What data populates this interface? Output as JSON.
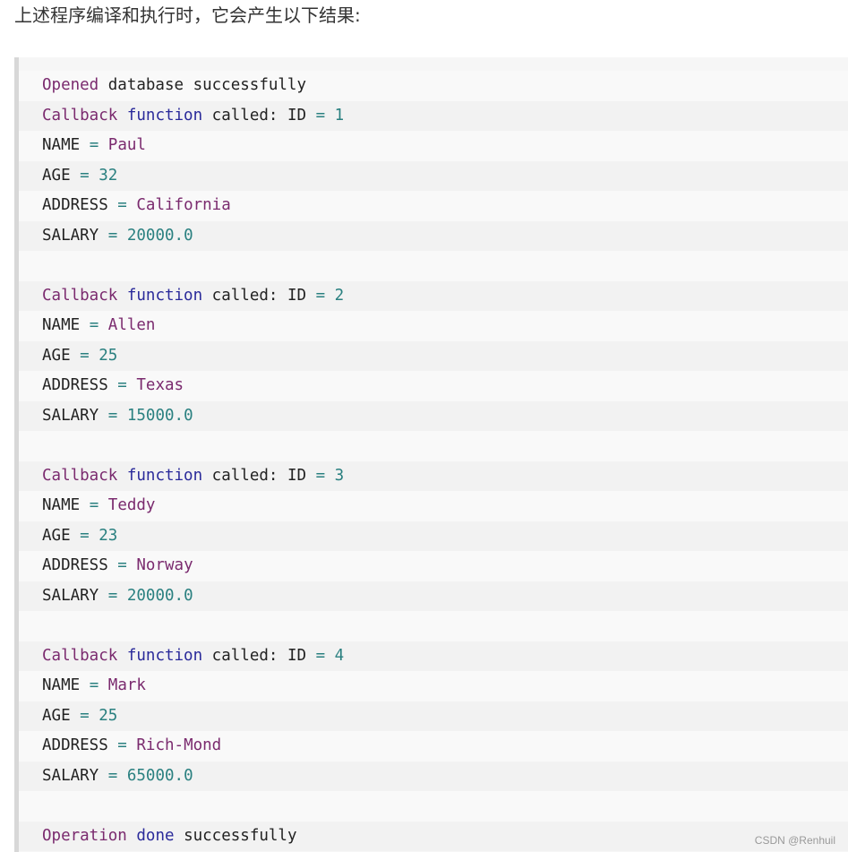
{
  "intro_text": "上述程序编译和执行时，它会产生以下结果:",
  "watermark": "CSDN @Renhuil",
  "colors": {
    "code_background": "#f6f6f6",
    "code_border": "#d8d8d8",
    "keyword": "#7a2a6e",
    "function_keyword": "#2a2a9a",
    "number": "#2a8080",
    "plain": "#222222"
  },
  "output_lines": [
    {
      "segments": [
        {
          "t": "Opened",
          "c": "kw"
        },
        {
          "t": " database successfully",
          "c": ""
        }
      ]
    },
    {
      "segments": [
        {
          "t": "Callback",
          "c": "kw"
        },
        {
          "t": " ",
          "c": ""
        },
        {
          "t": "function",
          "c": "fn"
        },
        {
          "t": " called: ID ",
          "c": ""
        },
        {
          "t": "=",
          "c": "op"
        },
        {
          "t": " ",
          "c": ""
        },
        {
          "t": "1",
          "c": "num"
        }
      ]
    },
    {
      "segments": [
        {
          "t": "NAME ",
          "c": ""
        },
        {
          "t": "=",
          "c": "op"
        },
        {
          "t": " ",
          "c": ""
        },
        {
          "t": "Paul",
          "c": "str"
        }
      ]
    },
    {
      "segments": [
        {
          "t": "AGE ",
          "c": ""
        },
        {
          "t": "=",
          "c": "op"
        },
        {
          "t": " ",
          "c": ""
        },
        {
          "t": "32",
          "c": "num"
        }
      ]
    },
    {
      "segments": [
        {
          "t": "ADDRESS ",
          "c": ""
        },
        {
          "t": "=",
          "c": "op"
        },
        {
          "t": " ",
          "c": ""
        },
        {
          "t": "California",
          "c": "str"
        }
      ]
    },
    {
      "segments": [
        {
          "t": "SALARY ",
          "c": ""
        },
        {
          "t": "=",
          "c": "op"
        },
        {
          "t": " ",
          "c": ""
        },
        {
          "t": "20000.0",
          "c": "num"
        }
      ]
    },
    {
      "segments": []
    },
    {
      "segments": [
        {
          "t": "Callback",
          "c": "kw"
        },
        {
          "t": " ",
          "c": ""
        },
        {
          "t": "function",
          "c": "fn"
        },
        {
          "t": " called: ID ",
          "c": ""
        },
        {
          "t": "=",
          "c": "op"
        },
        {
          "t": " ",
          "c": ""
        },
        {
          "t": "2",
          "c": "num"
        }
      ]
    },
    {
      "segments": [
        {
          "t": "NAME ",
          "c": ""
        },
        {
          "t": "=",
          "c": "op"
        },
        {
          "t": " ",
          "c": ""
        },
        {
          "t": "Allen",
          "c": "str"
        }
      ]
    },
    {
      "segments": [
        {
          "t": "AGE ",
          "c": ""
        },
        {
          "t": "=",
          "c": "op"
        },
        {
          "t": " ",
          "c": ""
        },
        {
          "t": "25",
          "c": "num"
        }
      ]
    },
    {
      "segments": [
        {
          "t": "ADDRESS ",
          "c": ""
        },
        {
          "t": "=",
          "c": "op"
        },
        {
          "t": " ",
          "c": ""
        },
        {
          "t": "Texas",
          "c": "str"
        }
      ]
    },
    {
      "segments": [
        {
          "t": "SALARY ",
          "c": ""
        },
        {
          "t": "=",
          "c": "op"
        },
        {
          "t": " ",
          "c": ""
        },
        {
          "t": "15000.0",
          "c": "num"
        }
      ]
    },
    {
      "segments": []
    },
    {
      "segments": [
        {
          "t": "Callback",
          "c": "kw"
        },
        {
          "t": " ",
          "c": ""
        },
        {
          "t": "function",
          "c": "fn"
        },
        {
          "t": " called: ID ",
          "c": ""
        },
        {
          "t": "=",
          "c": "op"
        },
        {
          "t": " ",
          "c": ""
        },
        {
          "t": "3",
          "c": "num"
        }
      ]
    },
    {
      "segments": [
        {
          "t": "NAME ",
          "c": ""
        },
        {
          "t": "=",
          "c": "op"
        },
        {
          "t": " ",
          "c": ""
        },
        {
          "t": "Teddy",
          "c": "str"
        }
      ]
    },
    {
      "segments": [
        {
          "t": "AGE ",
          "c": ""
        },
        {
          "t": "=",
          "c": "op"
        },
        {
          "t": " ",
          "c": ""
        },
        {
          "t": "23",
          "c": "num"
        }
      ]
    },
    {
      "segments": [
        {
          "t": "ADDRESS ",
          "c": ""
        },
        {
          "t": "=",
          "c": "op"
        },
        {
          "t": " ",
          "c": ""
        },
        {
          "t": "Norway",
          "c": "str"
        }
      ]
    },
    {
      "segments": [
        {
          "t": "SALARY ",
          "c": ""
        },
        {
          "t": "=",
          "c": "op"
        },
        {
          "t": " ",
          "c": ""
        },
        {
          "t": "20000.0",
          "c": "num"
        }
      ]
    },
    {
      "segments": []
    },
    {
      "segments": [
        {
          "t": "Callback",
          "c": "kw"
        },
        {
          "t": " ",
          "c": ""
        },
        {
          "t": "function",
          "c": "fn"
        },
        {
          "t": " called: ID ",
          "c": ""
        },
        {
          "t": "=",
          "c": "op"
        },
        {
          "t": " ",
          "c": ""
        },
        {
          "t": "4",
          "c": "num"
        }
      ]
    },
    {
      "segments": [
        {
          "t": "NAME ",
          "c": ""
        },
        {
          "t": "=",
          "c": "op"
        },
        {
          "t": " ",
          "c": ""
        },
        {
          "t": "Mark",
          "c": "str"
        }
      ]
    },
    {
      "segments": [
        {
          "t": "AGE ",
          "c": ""
        },
        {
          "t": "=",
          "c": "op"
        },
        {
          "t": " ",
          "c": ""
        },
        {
          "t": "25",
          "c": "num"
        }
      ]
    },
    {
      "segments": [
        {
          "t": "ADDRESS ",
          "c": ""
        },
        {
          "t": "=",
          "c": "op"
        },
        {
          "t": " ",
          "c": ""
        },
        {
          "t": "Rich-Mond",
          "c": "str"
        }
      ]
    },
    {
      "segments": [
        {
          "t": "SALARY ",
          "c": ""
        },
        {
          "t": "=",
          "c": "op"
        },
        {
          "t": " ",
          "c": ""
        },
        {
          "t": "65000.0",
          "c": "num"
        }
      ]
    },
    {
      "segments": []
    },
    {
      "segments": [
        {
          "t": "Operation",
          "c": "kw"
        },
        {
          "t": " ",
          "c": ""
        },
        {
          "t": "done",
          "c": "fn"
        },
        {
          "t": " successfully",
          "c": ""
        }
      ]
    }
  ]
}
